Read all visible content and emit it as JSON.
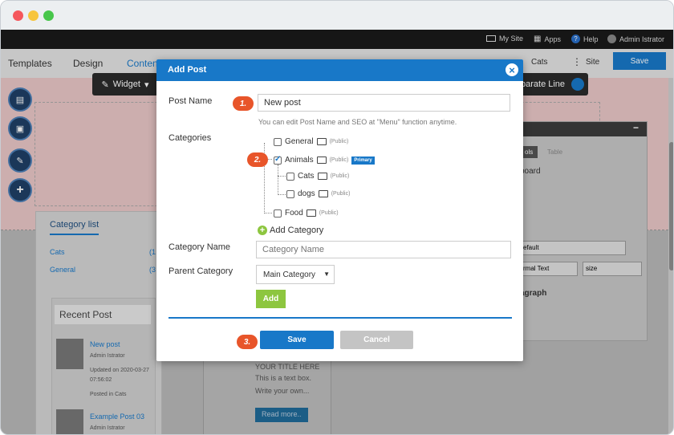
{
  "topbar": {
    "my_site": "My Site",
    "apps": "Apps",
    "help": "Help",
    "user": "Admin Istrator"
  },
  "toolbar": {
    "templates": "Templates",
    "design": "Design",
    "content": "Content",
    "cats": "Cats",
    "site": "Site",
    "save": "Save"
  },
  "editor": {
    "widget_label": "Widget",
    "separate_line": "parate Line",
    "category_list": {
      "title": "Category list",
      "items": [
        {
          "name": "Cats",
          "count": "(1"
        },
        {
          "name": "General",
          "count": "(3"
        }
      ]
    },
    "recent_post": {
      "title": "Recent Post",
      "posts": [
        {
          "title": "New post",
          "author": "Admin Istrator",
          "updated": "Updated on 2020-03-27 07:56:02",
          "category": "Posted in Cats"
        },
        {
          "title": "Example Post 03",
          "author": "Admin Istrator"
        }
      ]
    },
    "text_panel": {
      "title": "xt",
      "tab1": "ols",
      "tab2": "Table",
      "section1": "board",
      "section2": "t",
      "font_select": "efault",
      "style_select": "rmal Text",
      "size_select": "size",
      "paragraph": "agraph"
    },
    "textbox": {
      "heading": "YOUR TITLE HERE",
      "line1": "This is a text box.",
      "line2": "Write your own...",
      "read_more": "Read more.."
    }
  },
  "modal": {
    "title": "Add Post",
    "post_name_label": "Post Name",
    "post_name_value": "New post",
    "hint": "You can edit Post Name and SEO at \"Menu\" function anytime.",
    "categories_label": "Categories",
    "categories": [
      {
        "name": "General",
        "visibility": "(Public)",
        "checked": false
      },
      {
        "name": "Animals",
        "visibility": "(Public)",
        "checked": true,
        "badge": "Primary"
      },
      {
        "name": "Cats",
        "visibility": "(Public)",
        "checked": false
      },
      {
        "name": "dogs",
        "visibility": "(Public)",
        "checked": false
      },
      {
        "name": "Food",
        "visibility": "(Public)",
        "checked": false
      }
    ],
    "add_category_link": "Add Category",
    "category_name_label": "Category Name",
    "category_name_placeholder": "Category Name",
    "parent_category_label": "Parent Category",
    "parent_category_value": "Main Category",
    "add_button": "Add",
    "save_button": "Save",
    "cancel_button": "Cancel",
    "steps": [
      "1.",
      "2.",
      "3."
    ]
  },
  "colors": {
    "accent": "#1878c8",
    "step_badge": "#e8552a",
    "add_green": "#8dc63f",
    "cancel_grey": "#c4c4c4"
  }
}
